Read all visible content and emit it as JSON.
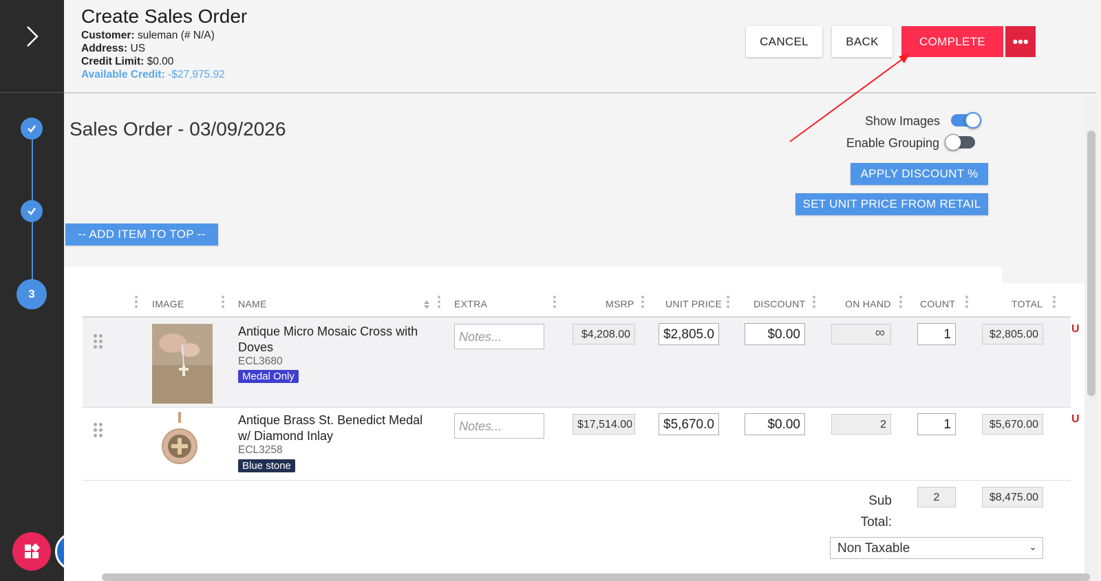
{
  "header": {
    "title": "Create Sales Order",
    "customer_label": "Customer:",
    "customer_value": "suleman (# N/A)",
    "address_label": "Address:",
    "address_value": "US",
    "credit_limit_label": "Credit Limit:",
    "credit_limit_value": "$0.00",
    "available_credit_label": "Available Credit:",
    "available_credit_value": "-$27,975.92",
    "cancel_label": "CANCEL",
    "back_label": "BACK",
    "complete_label": "COMPLETE",
    "more_label": "•••"
  },
  "sidebar": {
    "steps": [
      {
        "status": "done"
      },
      {
        "status": "done"
      },
      {
        "status": "current",
        "label": "3"
      }
    ]
  },
  "main": {
    "order_title": "Sales Order - 03/09/2026",
    "show_images_label": "Show Images",
    "show_images_on": true,
    "enable_grouping_label": "Enable Grouping",
    "enable_grouping_on": false,
    "apply_discount_label": "APPLY DISCOUNT %",
    "set_unit_price_label": "SET UNIT PRICE FROM RETAIL",
    "add_item_top_label": "-- ADD ITEM TO TOP --"
  },
  "table": {
    "columns": [
      "IMAGE",
      "NAME",
      "EXTRA",
      "MSRP",
      "UNIT PRICE",
      "DISCOUNT",
      "ON HAND",
      "COUNT",
      "TOTAL"
    ],
    "rows": [
      {
        "name": "Antique Micro Mosaic Cross with Doves",
        "sku": "ECL3680",
        "tag": "Medal Only",
        "notes_placeholder": "Notes...",
        "msrp": "$4,208.00",
        "unit_price": "$2,805.0",
        "discount": "$0.00",
        "on_hand": "∞",
        "count": "1",
        "total": "$2,805.00"
      },
      {
        "name": "Antique Brass St. Benedict Medal w/ Diamond Inlay",
        "sku": "ECL3258",
        "tag": "Blue stone",
        "notes_placeholder": "Notes...",
        "msrp": "$17,514.00",
        "unit_price": "$5,670.0",
        "discount": "$0.00",
        "on_hand": "2",
        "count": "1",
        "total": "$5,670.00"
      }
    ],
    "subtotal_label": "Sub Total:",
    "subtotal_count": "2",
    "subtotal_value": "$8,475.00",
    "tax_option": "Non Taxable"
  },
  "colors": {
    "accent": "#4f95e8",
    "complete": "#ff2d4e",
    "rail": "#2b2b2b",
    "tag_medal": "#3f3fcf",
    "tag_blue": "#223052"
  }
}
